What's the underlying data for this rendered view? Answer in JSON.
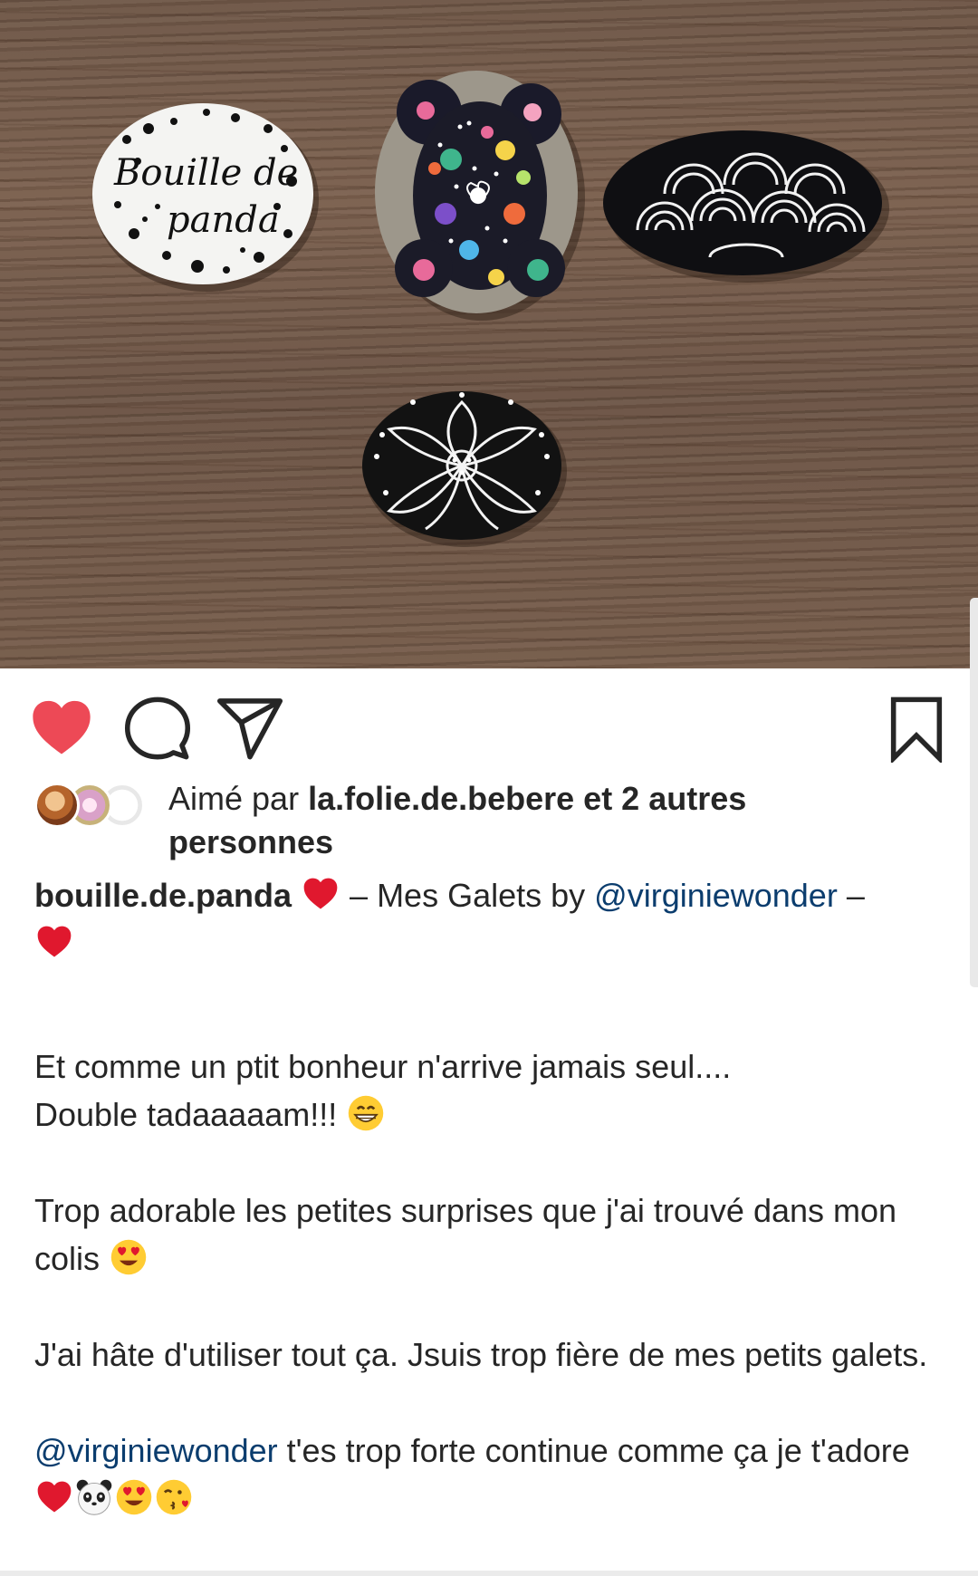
{
  "post": {
    "photo_text": {
      "line1": "Bouille de",
      "line2": "panda"
    },
    "likes": {
      "prefix": "Aimé par ",
      "user": "la.folie.de.bebere",
      "suffix": " et 2 autres personnes"
    },
    "caption": {
      "username": "bouille.de.panda",
      "title_text": " – Mes Galets by ",
      "title_mention": "@virginiewonder",
      "title_dash": " –",
      "para1_line1": "Et comme un ptit bonheur n'arrive jamais seul....",
      "para1_line2": "Double tadaaaaam!!! ",
      "para2": "Trop adorable les petites surprises que j'ai trouvé dans mon colis ",
      "para3": "J'ai hâte d'utiliser tout ça. Jsuis trop fière de mes petits galets.",
      "para4_mention": "@virginiewonder",
      "para4_text": " t'es trop forte continue comme ça je t'adore "
    },
    "colors": {
      "like_red": "#ed4956",
      "mention_blue": "#0b3d6e",
      "text": "#262626"
    },
    "icons": [
      "heart-icon",
      "comment-icon",
      "share-icon",
      "bookmark-icon"
    ]
  }
}
